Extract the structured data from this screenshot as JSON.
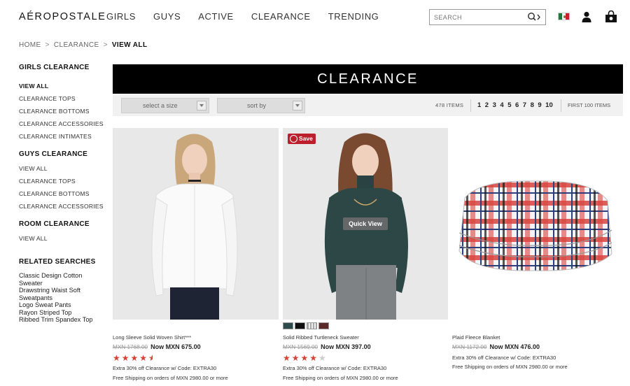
{
  "header": {
    "logo": "AÉROPOSTALE",
    "nav": [
      "GIRLS",
      "GUYS",
      "ACTIVE",
      "CLEARANCE",
      "TRENDING"
    ],
    "search_placeholder": "SEARCH",
    "search_icon": "search-icon",
    "flag": "mexico-flag-icon",
    "account_icon": "user-icon",
    "bag_icon": "shopping-bag-icon"
  },
  "breadcrumb": {
    "home": "HOME",
    "clearance": "CLEARANCE",
    "current": "VIEW ALL",
    "separator": ">"
  },
  "sidebar": {
    "girls": {
      "title": "GIRLS CLEARANCE",
      "items": [
        "VIEW ALL",
        "CLEARANCE TOPS",
        "CLEARANCE BOTTOMS",
        "CLEARANCE ACCESSORIES",
        "CLEARANCE INTIMATES"
      ]
    },
    "guys": {
      "title": "GUYS CLEARANCE",
      "items": [
        "VIEW ALL",
        "CLEARANCE TOPS",
        "CLEARANCE BOTTOMS",
        "CLEARANCE ACCESSORIES"
      ]
    },
    "room": {
      "title": "ROOM CLEARANCE",
      "items": [
        "VIEW ALL"
      ]
    },
    "related": {
      "title": "RELATED SEARCHES",
      "items": [
        "Classic Design Cotton Sweater",
        "Drawstring Waist Soft Sweatpants",
        "Logo Sweat Pants",
        "Rayon Striped Top",
        "Ribbed Trim Spandex Top"
      ]
    }
  },
  "banner": {
    "title": "CLEARANCE"
  },
  "toolbar": {
    "size_select": "select a size",
    "sort_select": "sort by",
    "items_count": "478  ITEMS",
    "pages": [
      "1",
      "2",
      "3",
      "4",
      "5",
      "6",
      "7",
      "8",
      "9",
      "10"
    ],
    "first_100": "FIRST 100 ITEMS"
  },
  "products": [
    {
      "name": "Long Sleeve Solid Woven Shirt***",
      "old_price": "MXN 1768.00",
      "now_price": "Now MXN 675.00",
      "rating": 4.5,
      "stars_full": "★★★★",
      "stars_empty": "",
      "promo": "Extra 30% off Clearance w/ Code: EXTRA30",
      "shipping": "Free Shipping on orders of MXN 2980.00 or more"
    },
    {
      "name": "Solid Ribbed Turtleneck Sweater",
      "old_price": "MXN 1569.00",
      "now_price": "Now MXN 397.00",
      "rating": 4,
      "stars_full": "★★★★",
      "stars_empty": "★",
      "promo": "Extra 30% off Clearance w/ Code: EXTRA30",
      "shipping": "Free Shipping on orders of MXN 2980.00 or more",
      "save_label": "Save",
      "quick_view": "Quick View",
      "swatch_colors": [
        "#2f4a4a",
        "#111111",
        "#9a9a9a",
        "#5a2a2a"
      ]
    },
    {
      "name": "Plaid Fleece Blanket",
      "old_price": "MXN 1172.00",
      "now_price": "Now MXN 476.00",
      "promo": "Extra 30% off Clearance w/ Code: EXTRA30",
      "shipping": "Free Shipping on orders of MXN 2980.00 or more"
    }
  ]
}
